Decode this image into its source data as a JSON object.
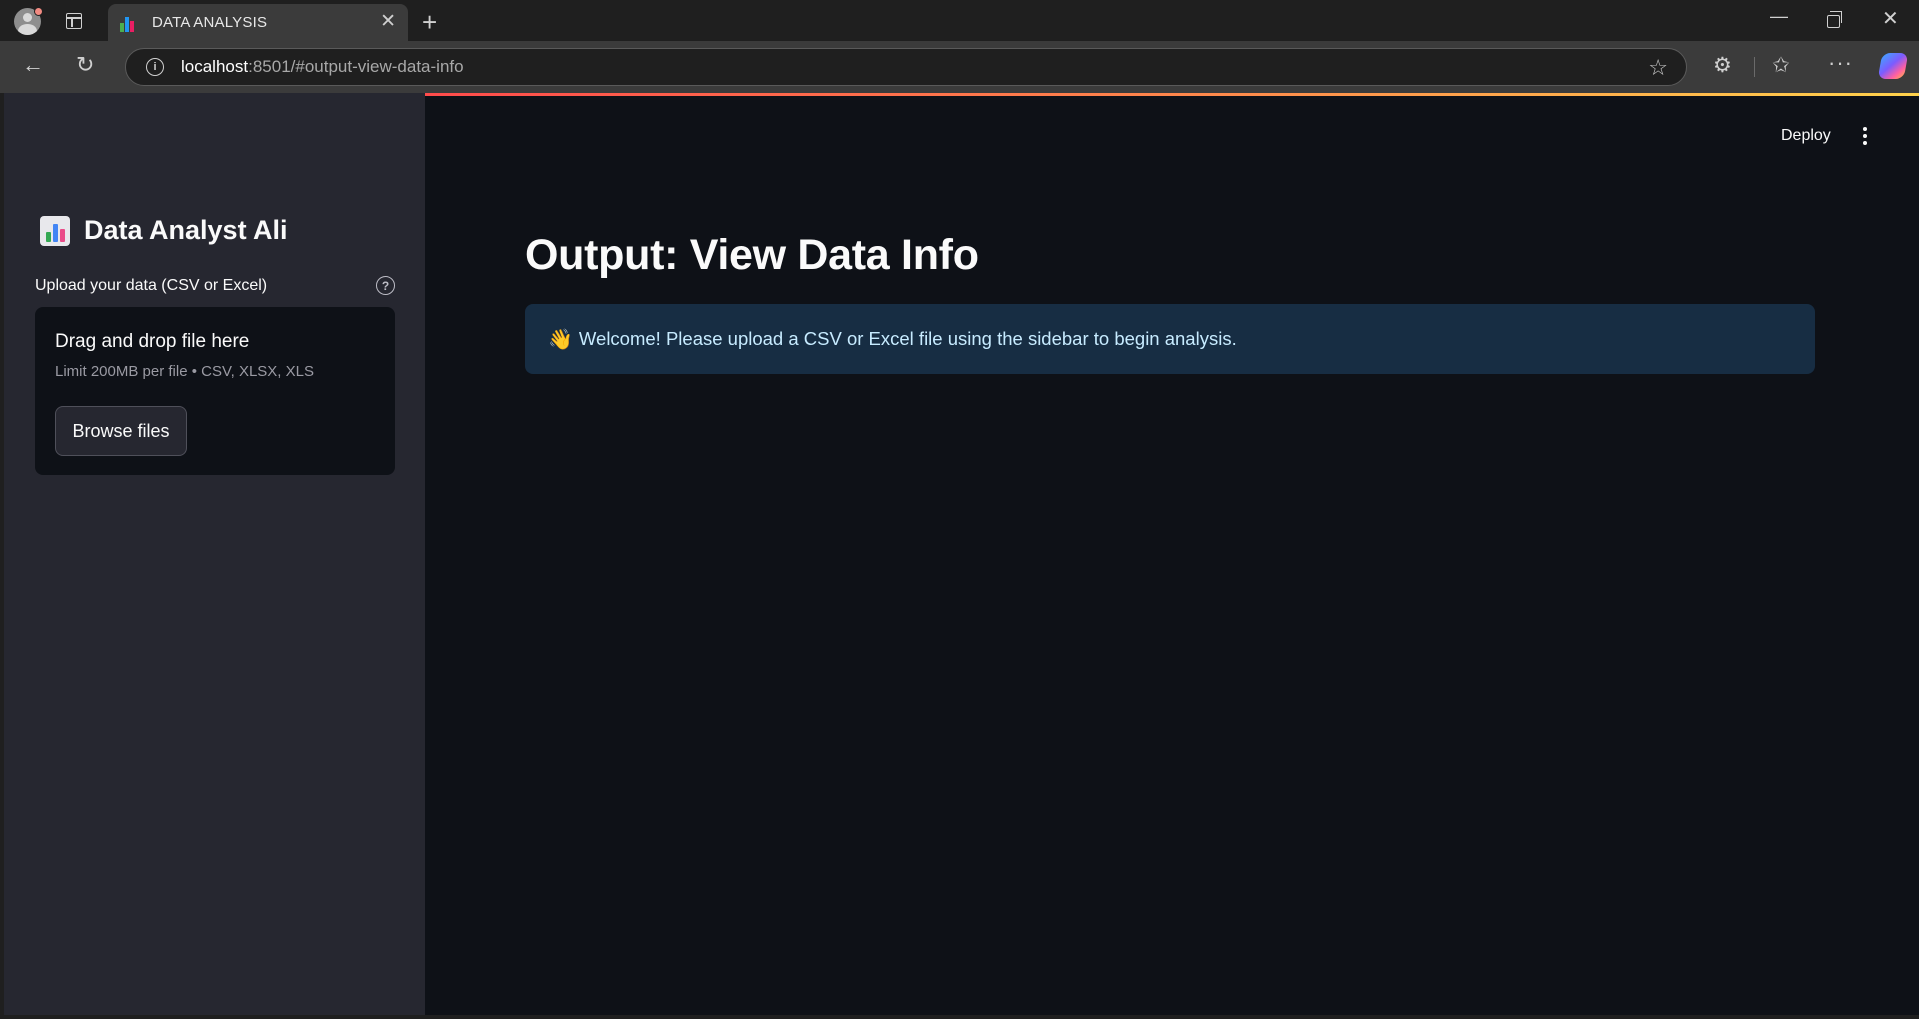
{
  "browser": {
    "tab_title": "DATA ANALYSIS",
    "url_host": "localhost",
    "url_rest": ":8501/#output-view-data-info"
  },
  "sidebar": {
    "title": "Data Analyst Ali",
    "upload_label": "Upload your data (CSV or Excel)",
    "dropzone": {
      "title": "Drag and drop file here",
      "limit": "Limit 200MB per file • CSV, XLSX, XLS",
      "browse_label": "Browse files"
    }
  },
  "header": {
    "deploy_label": "Deploy"
  },
  "main": {
    "title": "Output: View Data Info",
    "alert": {
      "icon": "👋",
      "text": "Welcome! Please upload a CSV or Excel file using the sidebar to begin analysis."
    }
  },
  "colors": {
    "sidebar_bg": "#262730",
    "main_bg": "#0e1117",
    "info_bg": "#172d43",
    "info_text": "#c7ebff",
    "accent": "#ff4b4b"
  }
}
